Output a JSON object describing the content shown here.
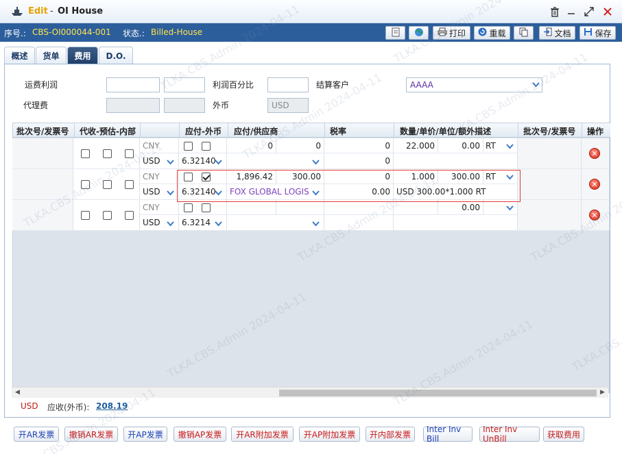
{
  "window": {
    "mode": "Edit",
    "separator": "-",
    "title": "OI House"
  },
  "info": {
    "seq_label": "序号.:",
    "seq_value": "CBS-OI000044-001",
    "status_label": "状态.:",
    "status_value": "Billed-House"
  },
  "toolbar": {
    "print": "打印",
    "reload": "重载",
    "docs": "文档",
    "save": "保存"
  },
  "tabs": [
    "概述",
    "货单",
    "费用",
    "D.O."
  ],
  "active_tab": "费用",
  "form": {
    "profit_label": "运费利润",
    "profit_pct_label": "利润百分比",
    "settle_label": "结算客户",
    "settle_value": "AAAA",
    "agency_label": "代理费",
    "foreign_label": "外币",
    "foreign_value": "USD"
  },
  "grid": {
    "headers": [
      "批次号/发票号",
      "代收-预估-内部",
      "应付-外币",
      "应付/供应商",
      "税率",
      "数量/单价/单位/额外描述",
      "批次号/发票号",
      "操作"
    ],
    "rows": [
      {
        "cur1": "CNY",
        "cur2": "USD",
        "rate": "6.32140",
        "amt": "0",
        "amt2": "0",
        "vendor": "",
        "tax": "0",
        "tax2": "0",
        "qty": "22.000",
        "price": "0.00",
        "unit": "RT",
        "desc": ""
      },
      {
        "cur1": "CNY",
        "cur2": "USD",
        "rate": "6.32140",
        "amt": "1,896.42",
        "amt2": "300.00",
        "vendor": "FOX GLOBAL LOGIS",
        "tax": "0",
        "tax2": "0.00",
        "qty": "1.000",
        "price": "300.00",
        "unit": "RT",
        "desc": "USD 300.00*1.000 RT"
      },
      {
        "cur1": "CNY",
        "cur2": "USD",
        "rate": "6.3214",
        "amt": "",
        "amt2": "",
        "vendor": "",
        "tax": "",
        "tax2": "",
        "qty": "",
        "price": "0.00",
        "unit": "",
        "desc": ""
      }
    ]
  },
  "footer": {
    "currency": "USD",
    "label": "应收(外币):",
    "value": "208.19"
  },
  "bottom_buttons": [
    {
      "label": "开AR发票",
      "color": "blue"
    },
    {
      "label": "撤销AR发票",
      "color": "red"
    },
    {
      "label": "开AP发票",
      "color": "blue"
    },
    {
      "label": "撤销AP发票",
      "color": "red"
    },
    {
      "label": "开AR附加发票",
      "color": "red"
    },
    {
      "label": "开AP附加发票",
      "color": "red"
    },
    {
      "label": "开内部发票",
      "color": "red"
    },
    {
      "label": "Inter Inv Bill",
      "color": "blue"
    },
    {
      "label": "Inter Inv UnBill",
      "color": "red"
    },
    {
      "label": "获取费用",
      "color": "red"
    }
  ],
  "watermark": "TLKA.CBS.Admin 2024-04-11",
  "colors": {
    "header_blue": "#2d5e9c",
    "status_yellow": "#ffe54c",
    "edit_orange": "#e8a300"
  }
}
